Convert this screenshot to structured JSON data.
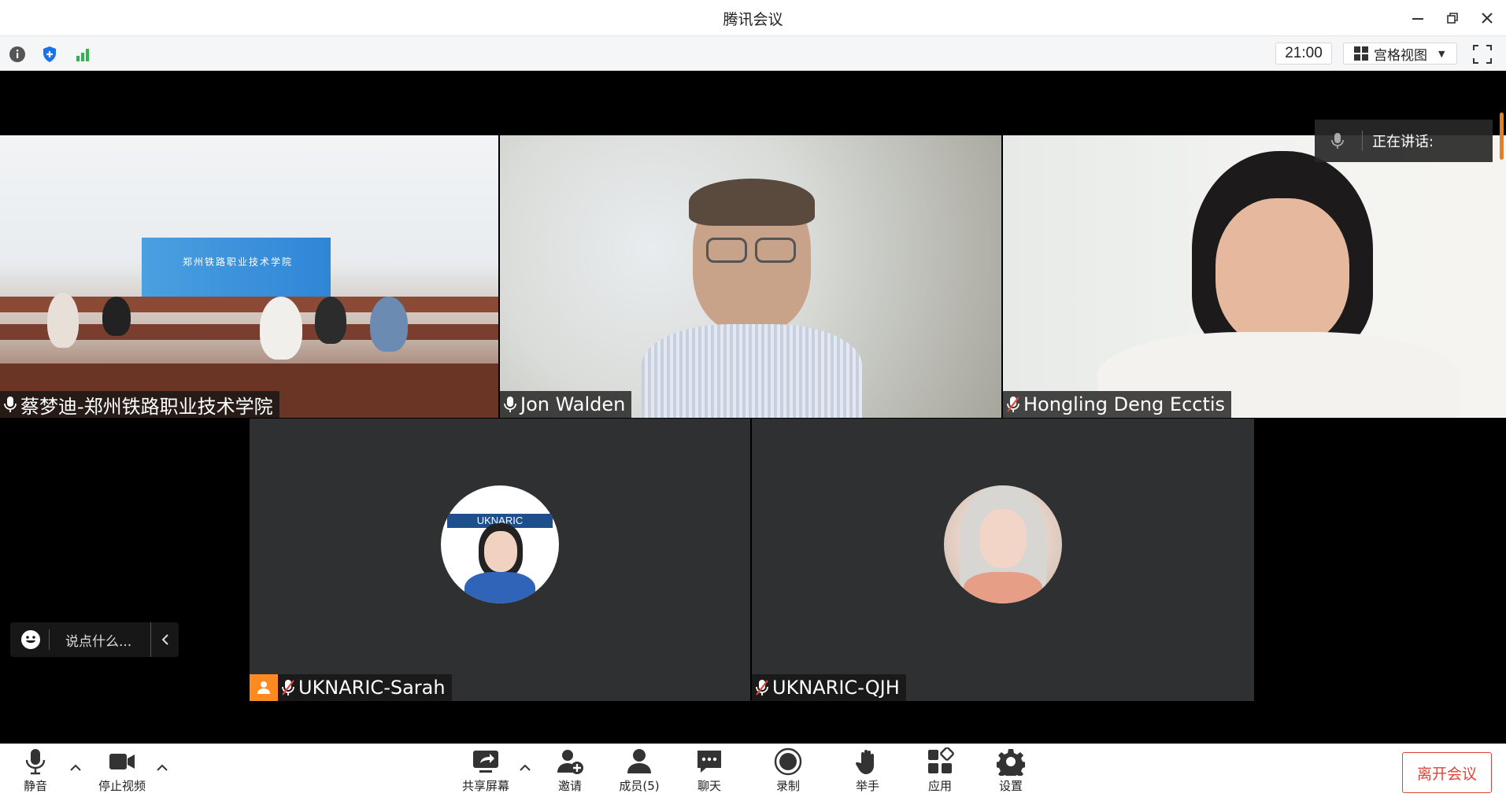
{
  "window": {
    "title": "腾讯会议"
  },
  "infobar": {
    "time": "21:00",
    "view_mode": "宫格视图"
  },
  "participants": [
    {
      "name": "蔡梦迪-郑州铁路职业技术学院",
      "muted": false,
      "banner_text": "郑州铁路职业技术学院"
    },
    {
      "name": "Jon Walden",
      "muted": false
    },
    {
      "name": "Hongling Deng Ecctis",
      "muted": true
    },
    {
      "name": "UKNARIC-Sarah",
      "muted": true,
      "host": true,
      "avatar_text": "UKNARIC"
    },
    {
      "name": "UKNARIC-QJH",
      "muted": true
    }
  ],
  "speaking_panel": {
    "label": "正在讲话:"
  },
  "chat": {
    "placeholder": "说点什么..."
  },
  "toolbar": {
    "mute": "静音",
    "stop_video": "停止视频",
    "share_screen": "共享屏幕",
    "invite": "邀请",
    "members": "成员(5)",
    "chat": "聊天",
    "record": "录制",
    "raise_hand": "举手",
    "apps": "应用",
    "settings": "设置",
    "leave": "离开会议"
  },
  "colors": {
    "accent_blue": "#1a73e8",
    "signal_green": "#2fb34a",
    "leave_red": "#e0453a",
    "host_orange": "#ff8a1f",
    "muted_red": "#e0453a"
  }
}
